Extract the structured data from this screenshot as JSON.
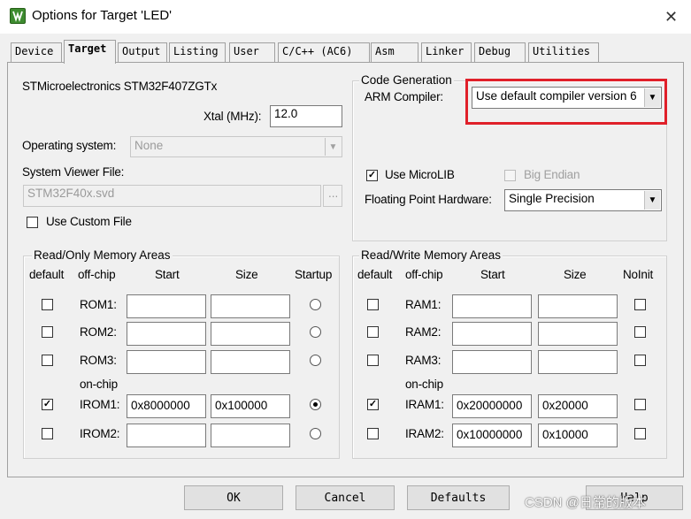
{
  "window": {
    "title": "Options for Target 'LED'",
    "close_glyph": "✕"
  },
  "tabs": [
    "Device",
    "Target",
    "Output",
    "Listing",
    "User",
    "C/C++ (AC6)",
    "Asm",
    "Linker",
    "Debug",
    "Utilities"
  ],
  "active_tab": "Target",
  "device_name": "STMicroelectronics STM32F407ZGTx",
  "xtal": {
    "label": "Xtal (MHz):",
    "value": "12.0"
  },
  "os": {
    "label": "Operating system:",
    "value": "None"
  },
  "svd": {
    "label": "System Viewer File:",
    "value": "STM32F40x.svd",
    "browse": "..."
  },
  "custom_file": {
    "label": "Use Custom File",
    "checked": false
  },
  "codegen": {
    "title": "Code Generation",
    "compiler_label": "ARM Compiler:",
    "compiler_value": "Use default compiler version 6",
    "microlib_label": "Use MicroLIB",
    "microlib_checked": true,
    "bigendian_label": "Big Endian",
    "fpu_label": "Floating Point Hardware:",
    "fpu_value": "Single Precision"
  },
  "ro": {
    "title": "Read/Only Memory Areas",
    "headers": {
      "default": "default",
      "offchip": "off-chip",
      "start": "Start",
      "size": "Size",
      "extra": "Startup"
    },
    "onchip": "on-chip",
    "rows": [
      {
        "name": "ROM1:",
        "start": "",
        "size": "",
        "checked": false,
        "radio": false
      },
      {
        "name": "ROM2:",
        "start": "",
        "size": "",
        "checked": false,
        "radio": false
      },
      {
        "name": "ROM3:",
        "start": "",
        "size": "",
        "checked": false,
        "radio": false
      },
      {
        "name": "IROM1:",
        "start": "0x8000000",
        "size": "0x100000",
        "checked": true,
        "radio": true
      },
      {
        "name": "IROM2:",
        "start": "",
        "size": "",
        "checked": false,
        "radio": false
      }
    ]
  },
  "rw": {
    "title": "Read/Write Memory Areas",
    "headers": {
      "default": "default",
      "offchip": "off-chip",
      "start": "Start",
      "size": "Size",
      "extra": "NoInit"
    },
    "onchip": "on-chip",
    "rows": [
      {
        "name": "RAM1:",
        "start": "",
        "size": "",
        "checked": false,
        "noinit": false
      },
      {
        "name": "RAM2:",
        "start": "",
        "size": "",
        "checked": false,
        "noinit": false
      },
      {
        "name": "RAM3:",
        "start": "",
        "size": "",
        "checked": false,
        "noinit": false
      },
      {
        "name": "IRAM1:",
        "start": "0x20000000",
        "size": "0x20000",
        "checked": true,
        "noinit": false
      },
      {
        "name": "IRAM2:",
        "start": "0x10000000",
        "size": "0x10000",
        "checked": false,
        "noinit": false
      }
    ]
  },
  "buttons": {
    "ok": "OK",
    "cancel": "Cancel",
    "defaults": "Defaults",
    "help": "Help"
  },
  "watermark": "CSDN @日常的版本",
  "colors": {
    "highlight": "#e0202a",
    "icon": "#3d8b2f"
  }
}
